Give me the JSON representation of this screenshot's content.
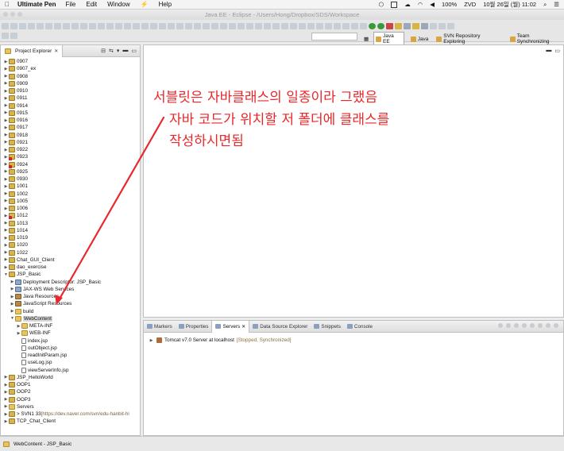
{
  "menubar": {
    "app": "Ultimate Pen",
    "items": [
      "File",
      "Edit",
      "Window",
      "Help"
    ],
    "battery": "100%",
    "battery_tag": "ZVD",
    "datetime": "10월 26일 (월) 11:02"
  },
  "window": {
    "title": "Java EE - Eclipse - /Users/Hong/Dropbox/SDS/Workspace"
  },
  "perspectives": [
    {
      "label": "Java EE",
      "active": true
    },
    {
      "label": "Java",
      "active": false
    },
    {
      "label": "SVN Repository Exploring",
      "active": false
    },
    {
      "label": "Team Synchronizing",
      "active": false
    }
  ],
  "explorer": {
    "tab_label": "Project Explorer",
    "rows": [
      {
        "label": "0907",
        "depth": 0,
        "twisty": "▶",
        "icon": "project"
      },
      {
        "label": "0907_ex",
        "depth": 0,
        "twisty": "▶",
        "icon": "project"
      },
      {
        "label": "0908",
        "depth": 0,
        "twisty": "▶",
        "icon": "project"
      },
      {
        "label": "0909",
        "depth": 0,
        "twisty": "▶",
        "icon": "project"
      },
      {
        "label": "0910",
        "depth": 0,
        "twisty": "▶",
        "icon": "project"
      },
      {
        "label": "0911",
        "depth": 0,
        "twisty": "▶",
        "icon": "project"
      },
      {
        "label": "0914",
        "depth": 0,
        "twisty": "▶",
        "icon": "project"
      },
      {
        "label": "0915",
        "depth": 0,
        "twisty": "▶",
        "icon": "project"
      },
      {
        "label": "0916",
        "depth": 0,
        "twisty": "▶",
        "icon": "project"
      },
      {
        "label": "0917",
        "depth": 0,
        "twisty": "▶",
        "icon": "project"
      },
      {
        "label": "0918",
        "depth": 0,
        "twisty": "▶",
        "icon": "project"
      },
      {
        "label": "0921",
        "depth": 0,
        "twisty": "▶",
        "icon": "project"
      },
      {
        "label": "0922",
        "depth": 0,
        "twisty": "▶",
        "icon": "project"
      },
      {
        "label": "0923",
        "depth": 0,
        "twisty": "▶",
        "icon": "project",
        "error": true
      },
      {
        "label": "0924",
        "depth": 0,
        "twisty": "▶",
        "icon": "project",
        "error": true
      },
      {
        "label": "0925",
        "depth": 0,
        "twisty": "▶",
        "icon": "project"
      },
      {
        "label": "0930",
        "depth": 0,
        "twisty": "▶",
        "icon": "project"
      },
      {
        "label": "1001",
        "depth": 0,
        "twisty": "▶",
        "icon": "project"
      },
      {
        "label": "1002",
        "depth": 0,
        "twisty": "▶",
        "icon": "project"
      },
      {
        "label": "1005",
        "depth": 0,
        "twisty": "▶",
        "icon": "project"
      },
      {
        "label": "1006",
        "depth": 0,
        "twisty": "▶",
        "icon": "project"
      },
      {
        "label": "1012",
        "depth": 0,
        "twisty": "▶",
        "icon": "project",
        "error": true
      },
      {
        "label": "1013",
        "depth": 0,
        "twisty": "▶",
        "icon": "project"
      },
      {
        "label": "1014",
        "depth": 0,
        "twisty": "▶",
        "icon": "project"
      },
      {
        "label": "1019",
        "depth": 0,
        "twisty": "▶",
        "icon": "project"
      },
      {
        "label": "1020",
        "depth": 0,
        "twisty": "▶",
        "icon": "project"
      },
      {
        "label": "1022",
        "depth": 0,
        "twisty": "▶",
        "icon": "project"
      },
      {
        "label": "Chat_GUI_Client",
        "depth": 0,
        "twisty": "▶",
        "icon": "project"
      },
      {
        "label": "dao_exercise",
        "depth": 0,
        "twisty": "▶",
        "icon": "project"
      },
      {
        "label": "JSP_Basic",
        "depth": 0,
        "twisty": "▼",
        "icon": "project"
      },
      {
        "label": "Deployment Descriptor: JSP_Basic",
        "depth": 1,
        "twisty": "▶",
        "icon": "desc"
      },
      {
        "label": "JAX-WS Web Services",
        "depth": 1,
        "twisty": "▶",
        "icon": "desc"
      },
      {
        "label": "Java Resources",
        "depth": 1,
        "twisty": "▶",
        "icon": "lib"
      },
      {
        "label": "JavaScript Resources",
        "depth": 1,
        "twisty": "▶",
        "icon": "lib"
      },
      {
        "label": "build",
        "depth": 1,
        "twisty": "▶",
        "icon": "folder"
      },
      {
        "label": "WebContent",
        "depth": 1,
        "twisty": "▼",
        "icon": "folder",
        "selected": true
      },
      {
        "label": "META-INF",
        "depth": 2,
        "twisty": "▶",
        "icon": "folder"
      },
      {
        "label": "WEB-INF",
        "depth": 2,
        "twisty": "▶",
        "icon": "folder"
      },
      {
        "label": "index.jsp",
        "depth": 2,
        "twisty": "",
        "icon": "file"
      },
      {
        "label": "outObject.jsp",
        "depth": 2,
        "twisty": "",
        "icon": "file"
      },
      {
        "label": "readInitParam.jsp",
        "depth": 2,
        "twisty": "",
        "icon": "file"
      },
      {
        "label": "useLog.jsp",
        "depth": 2,
        "twisty": "",
        "icon": "file"
      },
      {
        "label": "viewServerInfo.jsp",
        "depth": 2,
        "twisty": "",
        "icon": "file"
      },
      {
        "label": "JSP_HelloWorld",
        "depth": 0,
        "twisty": "▶",
        "icon": "project"
      },
      {
        "label": "OOP1",
        "depth": 0,
        "twisty": "▶",
        "icon": "project"
      },
      {
        "label": "OOP2",
        "depth": 0,
        "twisty": "▶",
        "icon": "project"
      },
      {
        "label": "OOP3",
        "depth": 0,
        "twisty": "▶",
        "icon": "project"
      },
      {
        "label": "Servers",
        "depth": 0,
        "twisty": "▶",
        "icon": "folder"
      },
      {
        "label": "> SVN1 33",
        "extra": " [https://dev.naver.com/svn/edu-hanbit-hi",
        "depth": 0,
        "twisty": "▶",
        "icon": "project"
      },
      {
        "label": "TCP_Chat_Client",
        "depth": 0,
        "twisty": "▶",
        "icon": "project"
      }
    ]
  },
  "bottom_panel": {
    "tabs": [
      {
        "label": "Markers",
        "active": false
      },
      {
        "label": "Properties",
        "active": false
      },
      {
        "label": "Servers",
        "active": true
      },
      {
        "label": "Data Source Explorer",
        "active": false
      },
      {
        "label": "Snippets",
        "active": false
      },
      {
        "label": "Console",
        "active": false
      }
    ],
    "server": {
      "name": "Tomcat v7.0 Server at localhost",
      "status": "[Stopped, Synchronized]"
    }
  },
  "statusbar": {
    "text": "WebContent - JSP_Basic"
  },
  "annotation": {
    "color": "#e8282a",
    "lines": [
      "서블릿은 자바클래스의 일종이라 그랬음",
      "자바 코드가 위치할 저 폴더에 클래스를",
      "작성하시면됨"
    ]
  }
}
